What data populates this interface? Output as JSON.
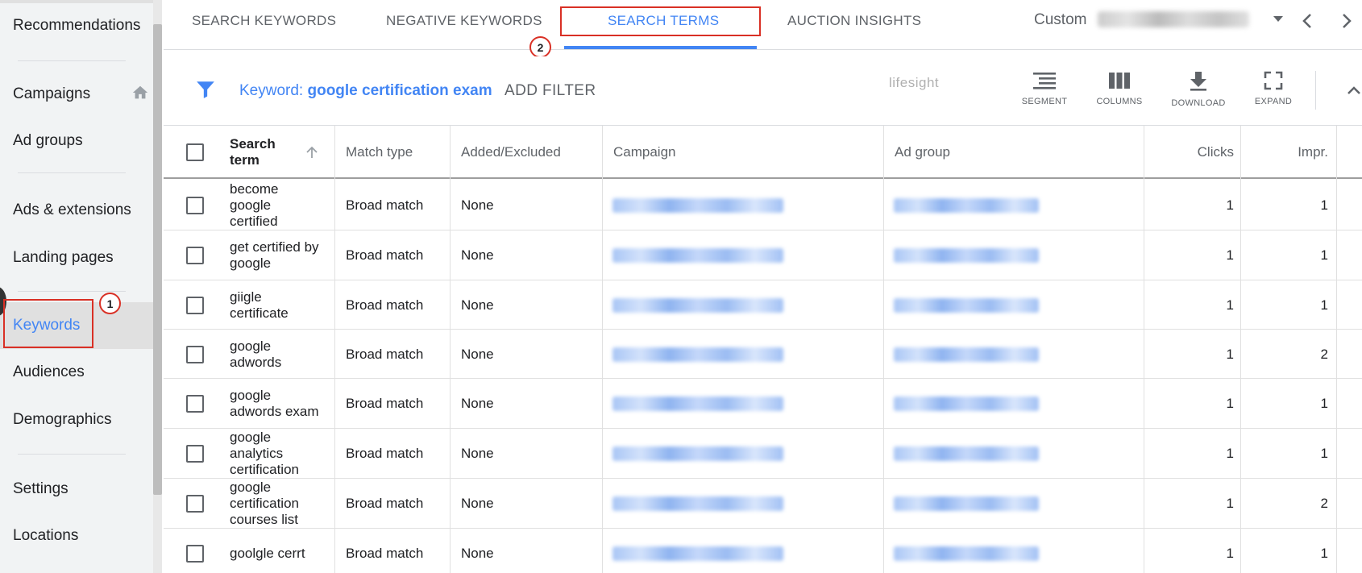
{
  "sidebar": {
    "items": [
      {
        "label": "Recommendations"
      },
      {
        "label": "Campaigns"
      },
      {
        "label": "Ad groups"
      },
      {
        "label": "Ads & extensions"
      },
      {
        "label": "Landing pages"
      },
      {
        "label": "Keywords"
      },
      {
        "label": "Audiences"
      },
      {
        "label": "Demographics"
      },
      {
        "label": "Settings"
      },
      {
        "label": "Locations"
      }
    ],
    "active_index": 5
  },
  "annotations": {
    "step1": "1",
    "step2": "2",
    "color": "#d93025"
  },
  "tabs": [
    {
      "label": "SEARCH KEYWORDS"
    },
    {
      "label": "NEGATIVE KEYWORDS"
    },
    {
      "label": "SEARCH TERMS"
    },
    {
      "label": "AUCTION INSIGHTS"
    }
  ],
  "date": {
    "label": "Custom"
  },
  "filter": {
    "prefix": "Keyword: ",
    "value": "google certification exam",
    "add_label": "ADD FILTER"
  },
  "watermark": "lifesight",
  "tools": {
    "segment": "SEGMENT",
    "columns": "COLUMNS",
    "download": "DOWNLOAD",
    "expand": "EXPAND"
  },
  "table": {
    "headers": {
      "search_term_1": "Search",
      "search_term_2": "term",
      "match_type": "Match type",
      "added_excluded": "Added/Excluded",
      "campaign": "Campaign",
      "ad_group": "Ad group",
      "clicks": "Clicks",
      "impr": "Impr."
    },
    "rows": [
      {
        "term": [
          "become",
          "google",
          "certified"
        ],
        "match": "Broad match",
        "added": "None",
        "clicks": "1",
        "impr": "1"
      },
      {
        "term": [
          "get certified by",
          "google"
        ],
        "match": "Broad match",
        "added": "None",
        "clicks": "1",
        "impr": "1"
      },
      {
        "term": [
          "giigle",
          "certificate"
        ],
        "match": "Broad match",
        "added": "None",
        "clicks": "1",
        "impr": "1"
      },
      {
        "term": [
          "google",
          "adwords"
        ],
        "match": "Broad match",
        "added": "None",
        "clicks": "1",
        "impr": "2"
      },
      {
        "term": [
          "google",
          "adwords exam"
        ],
        "match": "Broad match",
        "added": "None",
        "clicks": "1",
        "impr": "1"
      },
      {
        "term": [
          "google",
          "analytics",
          "certification"
        ],
        "match": "Broad match",
        "added": "None",
        "clicks": "1",
        "impr": "1"
      },
      {
        "term": [
          "google",
          "certification",
          "courses list"
        ],
        "match": "Broad match",
        "added": "None",
        "clicks": "1",
        "impr": "2"
      },
      {
        "term": [
          "goolgle cerrt"
        ],
        "match": "Broad match",
        "added": "None",
        "clicks": "1",
        "impr": "1"
      }
    ]
  },
  "colors": {
    "accent": "#4285f4",
    "annotation": "#d93025",
    "sidebar_bg": "#f1f3f4"
  }
}
